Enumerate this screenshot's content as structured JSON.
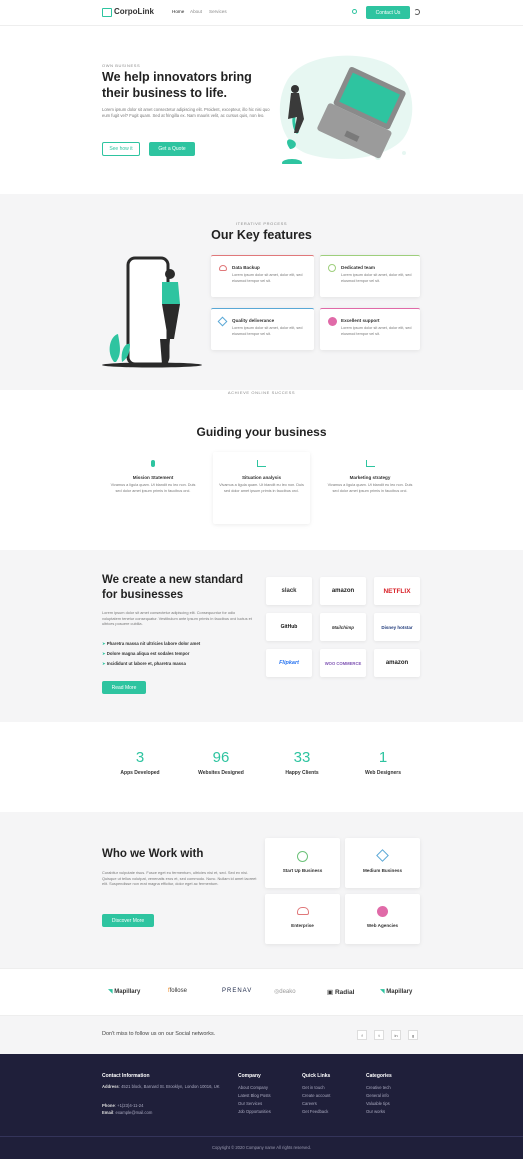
{
  "header": {
    "brand": "CorpoLink",
    "nav": [
      "Home",
      "About",
      "Services"
    ],
    "contact_label": "Contact Us"
  },
  "hero": {
    "eyebrow": "OWN BUSINESS",
    "title_line1": "We help innovators bring",
    "title_line2": "their business to life.",
    "text": "Lorem ipsum dolor sit amet consectetur adipiscing elit. Proident, excepteur, illo hic nisi quo eum fugit vel? Fugit quam. Sed at fringilla ex. Nam mauris velit, ac cursus quis, non leo.",
    "btn_see": "See how it",
    "btn_quote": "Get a Quote"
  },
  "features": {
    "eyebrow": "ITERATIVE PROCESS",
    "title": "Our Key features",
    "items": [
      {
        "title": "Data Backup",
        "text": "Lorem ipsum dolor sit amet, dolor elit, sed eiusmod tempor vel sit.",
        "color": "#e0787a",
        "icon": "cloud-icon"
      },
      {
        "title": "Dedicated team",
        "text": "Lorem ipsum dolor sit amet, dolor elit, sed eiusmod tempor vel sit.",
        "color": "#9ecf7c",
        "icon": "team-icon"
      },
      {
        "title": "Quality deliverance",
        "text": "Lorem ipsum dolor sit amet, dolor elit, sed eiusmod tempor vel sit.",
        "color": "#5aa8d6",
        "icon": "tag-icon"
      },
      {
        "title": "Excellent support",
        "text": "Lorem ipsum dolor sit amet, dolor elit, sed eiusmod tempor vel sit.",
        "color": "#e06aa8",
        "icon": "support-icon"
      }
    ]
  },
  "guide": {
    "eyebrow": "ACHIEVE ONLINE SUCCESS",
    "title": "Guiding your business",
    "items": [
      {
        "title": "Mission Statement",
        "text": "Vivamus a ligula quam. Ut blandit eu leo non. Duis sed dolor amet ipsum primis in faucibus orci."
      },
      {
        "title": "Situation analysis",
        "text": "Vivamus a ligula quam. Ut blandit eu leo non. Duis sed dolor amet ipsum primis in faucibus orci."
      },
      {
        "title": "Marketing strategy",
        "text": "Vivamus a ligula quam. Ut blandit eu leo non. Duis sed dolor amet ipsum primis in faucibus orci."
      }
    ]
  },
  "standard": {
    "title_line1": "We create a new standard",
    "title_line2": "for businesses",
    "text": "Lorem ipsum dolor sit amet consectetur adipiscing elit. Consequuntur for odio voluptatem tenetur consequatur. Vestibulum ante ipsum primis in faucibus orci luctus et ultrices posuere cubilia.",
    "bullets": [
      "Pharetra massa nit ultricies labore dolor amet",
      "Dolore magna aliqua est sodales tempor",
      "Incididunt ut labore et, pharetra massa"
    ],
    "button": "Read More",
    "logos": [
      "slack",
      "amazon",
      "NETFLIX",
      "GitHub",
      "Mailchimp",
      "Disney hotstar",
      "Flipkart",
      "WOO COMMERCE",
      "amazon"
    ]
  },
  "stats": [
    {
      "num": "3",
      "label": "Apps Developed"
    },
    {
      "num": "96",
      "label": "Websites Designed"
    },
    {
      "num": "33",
      "label": "Happy Clients"
    },
    {
      "num": "1",
      "label": "Web Designers"
    }
  ],
  "work": {
    "title": "Who we Work with",
    "text": "Curabitur vulputate risus. Fusce eget eu fermentum, ultricies nisi et, sed. Sed ex nisi. Quisque ut tellus volutpat, venenatis eros et, sed commodo. Nunc. Nullam id amet laoreet elit. Suspendisse non erat magna efficitur, dolor eget ac fermentum.",
    "button": "Discover More",
    "items": [
      {
        "title": "Start Up Business",
        "icon": "globe-icon",
        "color": "#6cc27a"
      },
      {
        "title": "Medium Business",
        "icon": "tag-icon",
        "color": "#5aa8d6"
      },
      {
        "title": "Enterprise",
        "icon": "cloud-icon",
        "color": "#e0787a"
      },
      {
        "title": "Web Agencies",
        "icon": "support-icon",
        "color": "#e06aa8"
      }
    ]
  },
  "clients": [
    "Mapillary",
    "follose",
    "PRENAV",
    "deako",
    "Radial",
    "Mapillary"
  ],
  "social": {
    "text": "Don't miss to follow us on our Social networks.",
    "icons": [
      "f",
      "t",
      "in",
      "g"
    ]
  },
  "footer": {
    "contact_title": "Contact Information",
    "address_label": "Address",
    "address": ": 4521 block, Barnard St. Brooklyn, London 10016, UK",
    "phone_label": "Phone",
    "phone": ": +1(23)4-11-24",
    "email_label": "Email",
    "email": ": example@mail.com",
    "company_title": "Company",
    "company": [
      "About Company",
      "Latest Blog Posts",
      "Our Services",
      "Job Opportunities"
    ],
    "quick_title": "Quick Links",
    "quick": [
      "Get in touch",
      "Create account",
      "Careers",
      "Get Feedback"
    ],
    "cat_title": "Categories",
    "cat": [
      "Creative tech",
      "General info",
      "Valuable tips",
      "Our works"
    ],
    "copyright": "Copyright © 2020 Company name All rights reserved."
  }
}
